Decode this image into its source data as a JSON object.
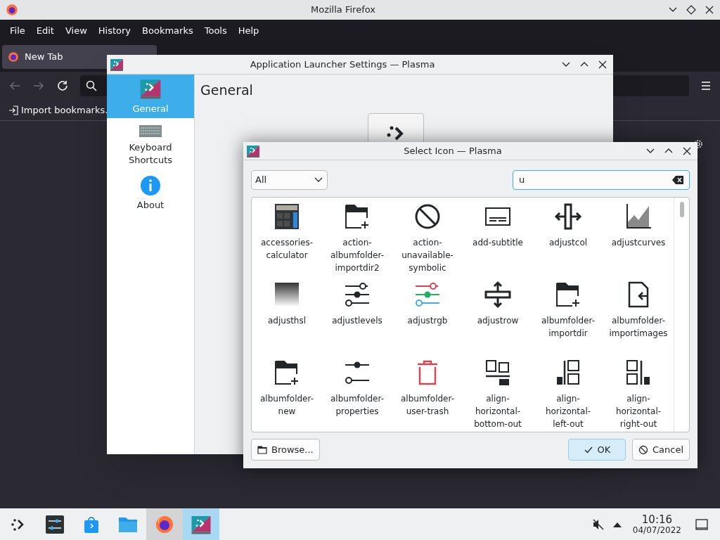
{
  "firefox": {
    "title": "Mozilla Firefox",
    "menu": [
      "File",
      "Edit",
      "View",
      "History",
      "Bookmarks",
      "Tools",
      "Help"
    ],
    "tabs": [
      {
        "label": "New Tab",
        "selected": true
      }
    ],
    "bookmarks": [
      "Import bookmarks."
    ]
  },
  "settings_window": {
    "title": "Application Launcher Settings — Plasma",
    "heading": "General",
    "sidebar": [
      {
        "kind": "launcher",
        "label": "General",
        "selected": true
      },
      {
        "kind": "keyboard",
        "label": "Keyboard Shortcuts",
        "selected": false
      },
      {
        "kind": "about",
        "label": "About",
        "selected": false
      }
    ]
  },
  "dialog": {
    "title": "Select Icon — Plasma",
    "filter": "All",
    "search": "u",
    "icons": [
      {
        "kind": "calculator",
        "label": "accessories-calculator"
      },
      {
        "kind": "folder-plus",
        "label": "action-albumfolder-importdir2"
      },
      {
        "kind": "prohibited",
        "label": "action-unavailable-symbolic"
      },
      {
        "kind": "subtitle",
        "label": "add-subtitle"
      },
      {
        "kind": "col",
        "label": "adjustcol"
      },
      {
        "kind": "curves",
        "label": "adjustcurves"
      },
      {
        "kind": "gradient",
        "label": "adjusthsl"
      },
      {
        "kind": "sliders",
        "label": "adjustlevels"
      },
      {
        "kind": "sliders-color",
        "label": "adjustrgb"
      },
      {
        "kind": "row",
        "label": "adjustrow"
      },
      {
        "kind": "folder-plus",
        "label": "albumfolder-importdir"
      },
      {
        "kind": "file-import",
        "label": "albumfolder-importimages"
      },
      {
        "kind": "folder-plus",
        "label": "albumfolder-new"
      },
      {
        "kind": "sliders2",
        "label": "albumfolder-properties"
      },
      {
        "kind": "trash",
        "label": "albumfolder-user-trash"
      },
      {
        "kind": "align-bottom",
        "label": "align-horizontal-bottom-out"
      },
      {
        "kind": "align-left",
        "label": "align-horizontal-left-out"
      },
      {
        "kind": "align-right",
        "label": "align-horizontal-right-out"
      }
    ],
    "buttons": [
      {
        "kind": "browse",
        "label": "Browse...",
        "default": false
      },
      {
        "kind": "ok",
        "label": "OK",
        "default": true
      },
      {
        "kind": "cancel",
        "label": "Cancel",
        "default": false
      }
    ]
  },
  "taskbar": {
    "tasks": [
      {
        "kind": "launcher",
        "open": false,
        "selected": false
      },
      {
        "kind": "settings",
        "open": false,
        "selected": false
      },
      {
        "kind": "store",
        "open": false,
        "selected": false
      },
      {
        "kind": "files",
        "open": false,
        "selected": false
      },
      {
        "kind": "firefox",
        "open": true,
        "selected": false
      },
      {
        "kind": "plasma",
        "open": true,
        "selected": true
      }
    ],
    "time": "10:16",
    "date": "04/07/2022"
  }
}
